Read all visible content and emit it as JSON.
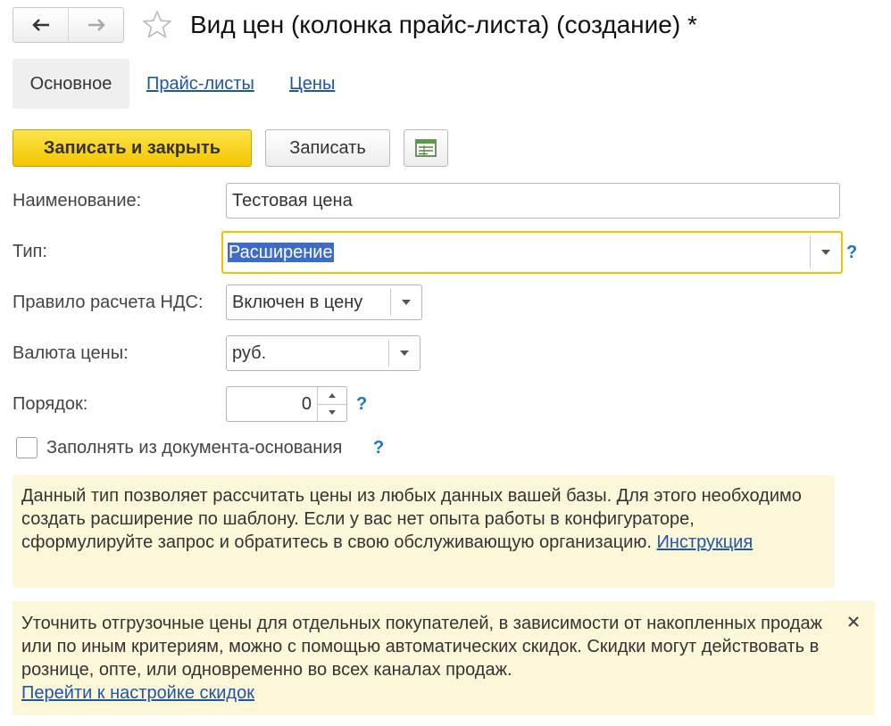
{
  "window": {
    "title": "Вид цен (колонка прайс-листа) (создание) *",
    "icons": {
      "back": "arrow-left-icon",
      "forward": "arrow-right-icon",
      "favorite": "star-outline-icon"
    }
  },
  "tabs": [
    {
      "label": "Основное",
      "active": true
    },
    {
      "label": "Прайс-листы",
      "active": false
    },
    {
      "label": "Цены",
      "active": false
    }
  ],
  "toolbar": {
    "save_close_label": "Записать и закрыть",
    "save_label": "Записать",
    "extra_icon": "report-table-icon"
  },
  "form": {
    "name": {
      "label": "Наименование:",
      "value": "Тестовая цена"
    },
    "type": {
      "label": "Тип:",
      "value": "Расширение"
    },
    "vat": {
      "label": "Правило расчета НДС:",
      "value": "Включен в цену"
    },
    "currency": {
      "label": "Валюта цены:",
      "value": "руб."
    },
    "order": {
      "label": "Порядок:",
      "value": "0"
    },
    "fill_from_base": {
      "label": "Заполнять из документа-основания",
      "checked": false
    },
    "help_mark": "?"
  },
  "info_panel": {
    "text": "Данный тип позволяет рассчитать цены из любых данных вашей базы. Для этого необходимо создать расширение по шаблону. Если у вас нет опыта работы в конфигураторе, сформулируйте запрос и обратитесь в свою обслуживающую организацию.",
    "link": "Инструкция"
  },
  "discount_panel": {
    "text": "Уточнить отгрузочные цены для отдельных покупателей, в зависимости от накопленных продаж или по иным критериям, можно с помощью автоматических скидок. Скидки могут действовать в рознице, опте, или одновременно во всех каналах продаж.",
    "link": "Перейти к настройке скидок",
    "close_icon": "close-icon"
  },
  "colors": {
    "accent_yellow": "#f5c400",
    "focus_border": "#f0c300",
    "link": "#1f56a8",
    "help": "#1f74c9",
    "panel_bg": "#fcf7d8",
    "selection": "#3d6cc8"
  }
}
